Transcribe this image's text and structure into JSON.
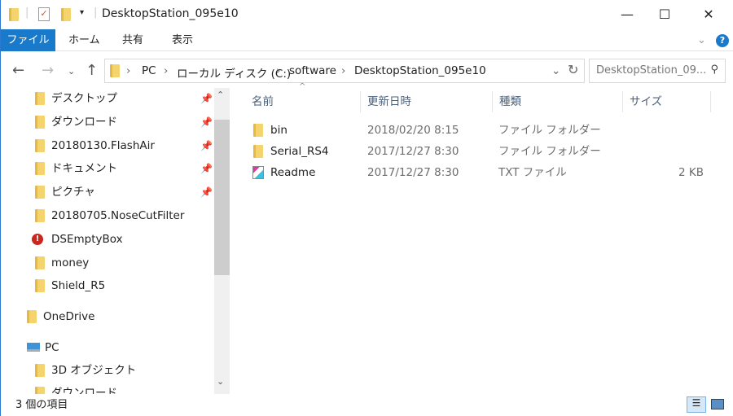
{
  "window": {
    "title": "DesktopStation_095e10",
    "minimize": "—",
    "maximize": "☐",
    "close": "✕"
  },
  "ribbon": {
    "tabs": [
      "ファイル",
      "ホーム",
      "共有",
      "表示"
    ],
    "help": "?",
    "expand": "⌄"
  },
  "address": {
    "crumbs": [
      "PC",
      "ローカル ディスク (C:)",
      "software",
      "DesktopStation_095e10"
    ],
    "search_placeholder": "DesktopStation_09..."
  },
  "nav": {
    "items": [
      {
        "label": "デスクトップ",
        "pinned": true,
        "icon": "desktop-folder-icon"
      },
      {
        "label": "ダウンロード",
        "pinned": true,
        "icon": "download-folder-icon"
      },
      {
        "label": "20180130.FlashAir",
        "pinned": true,
        "icon": "folder-icon"
      },
      {
        "label": "ドキュメント",
        "pinned": true,
        "icon": "documents-folder-icon"
      },
      {
        "label": "ピクチャ",
        "pinned": true,
        "icon": "pictures-folder-icon"
      },
      {
        "label": "20180705.NoseCutFilter",
        "pinned": false,
        "icon": "folder-icon"
      },
      {
        "label": "DSEmptyBox",
        "pinned": false,
        "icon": "error-folder-icon"
      },
      {
        "label": "money",
        "pinned": false,
        "icon": "folder-icon"
      },
      {
        "label": "Shield_R5",
        "pinned": false,
        "icon": "folder-icon"
      }
    ],
    "onedrive": "OneDrive",
    "pc": "PC",
    "pc_items": [
      "3D オブジェクト",
      "ダウンロード"
    ]
  },
  "columns": [
    "名前",
    "更新日時",
    "種類",
    "サイズ"
  ],
  "files": [
    {
      "name": "bin",
      "date": "2018/02/20 8:15",
      "type": "ファイル フォルダー",
      "size": "",
      "icon": "folder-icon"
    },
    {
      "name": "Serial_RS4",
      "date": "2017/12/27 8:30",
      "type": "ファイル フォルダー",
      "size": "",
      "icon": "folder-icon"
    },
    {
      "name": "Readme",
      "date": "2017/12/27 8:30",
      "type": "TXT ファイル",
      "size": "2 KB",
      "icon": "text-file-icon"
    }
  ],
  "status": {
    "count": "3 個の項目"
  }
}
